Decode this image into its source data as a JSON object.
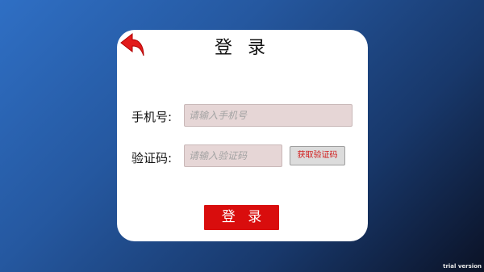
{
  "login_card": {
    "back_icon": "back-arrow-icon",
    "title": "登 录",
    "phone": {
      "label": "手机号:",
      "placeholder": "请输入手机号",
      "value": ""
    },
    "code": {
      "label": "验证码:",
      "placeholder": "请输入验证码",
      "value": ""
    },
    "get_code_label": "获取验证码",
    "login_label": "登 录"
  },
  "watermark": "trial version",
  "colors": {
    "accent": "#d90d0d",
    "input_bg": "#e6d6d6",
    "background_start": "#2f6fc4",
    "background_end": "#0b1226"
  }
}
